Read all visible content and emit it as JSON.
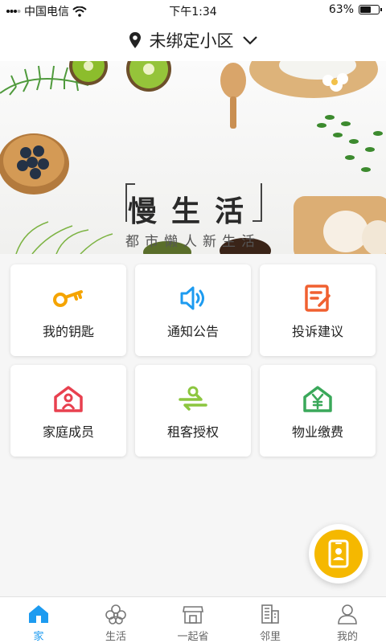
{
  "status_bar": {
    "carrier": "中国电信",
    "time": "下午1:34",
    "battery_text": "63%",
    "battery_level": 0.63
  },
  "header": {
    "title": "未绑定小区",
    "location_icon": "location-pin-icon",
    "dropdown_icon": "chevron-down-icon"
  },
  "banner": {
    "title": "慢生活",
    "subtitle": "都市懒人新生活"
  },
  "tiles": [
    {
      "label": "我的钥匙",
      "icon": "key-icon",
      "color": "#f5a400"
    },
    {
      "label": "通知公告",
      "icon": "speaker-icon",
      "color": "#1d9bf0"
    },
    {
      "label": "投诉建议",
      "icon": "edit-note-icon",
      "color": "#f06030"
    },
    {
      "label": "家庭成员",
      "icon": "family-home-icon",
      "color": "#e8404f"
    },
    {
      "label": "租客授权",
      "icon": "tenant-auth-icon",
      "color": "#8cc63f"
    },
    {
      "label": "物业缴费",
      "icon": "payment-house-icon",
      "color": "#3aa85a"
    }
  ],
  "fab": {
    "icon": "phone-contact-icon",
    "color": "#f5b800"
  },
  "tabbar": {
    "items": [
      {
        "label": "家",
        "icon": "home-icon",
        "active": true
      },
      {
        "label": "生活",
        "icon": "flower-icon",
        "active": false
      },
      {
        "label": "一起省",
        "icon": "shop-icon",
        "active": false
      },
      {
        "label": "邻里",
        "icon": "building-icon",
        "active": false
      },
      {
        "label": "我的",
        "icon": "user-icon",
        "active": false
      }
    ],
    "active_color": "#1d9bf0",
    "inactive_color": "#666666"
  }
}
